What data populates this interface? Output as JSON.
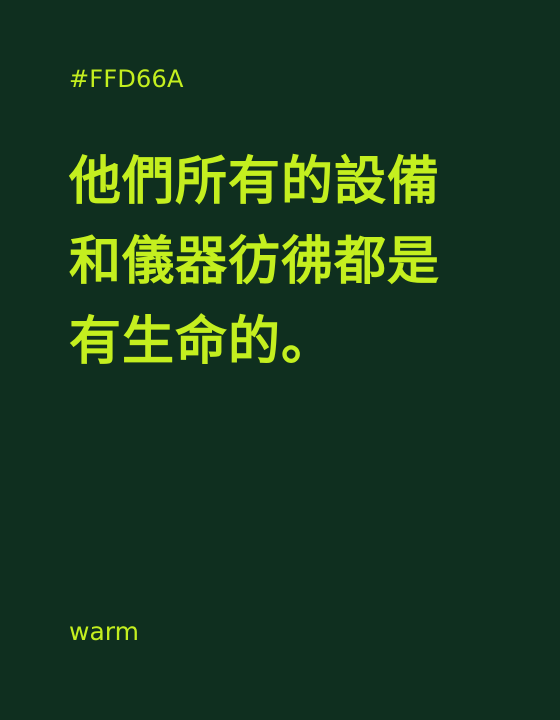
{
  "card": {
    "hex_label": "#FFD66A",
    "quote_lines": [
      "他們所有的設備",
      "和儀器彷彿都是",
      "有生命的。"
    ],
    "footer_word": "warm"
  },
  "colors": {
    "background": "#0f2f1f",
    "text": "#c4ef1f"
  }
}
